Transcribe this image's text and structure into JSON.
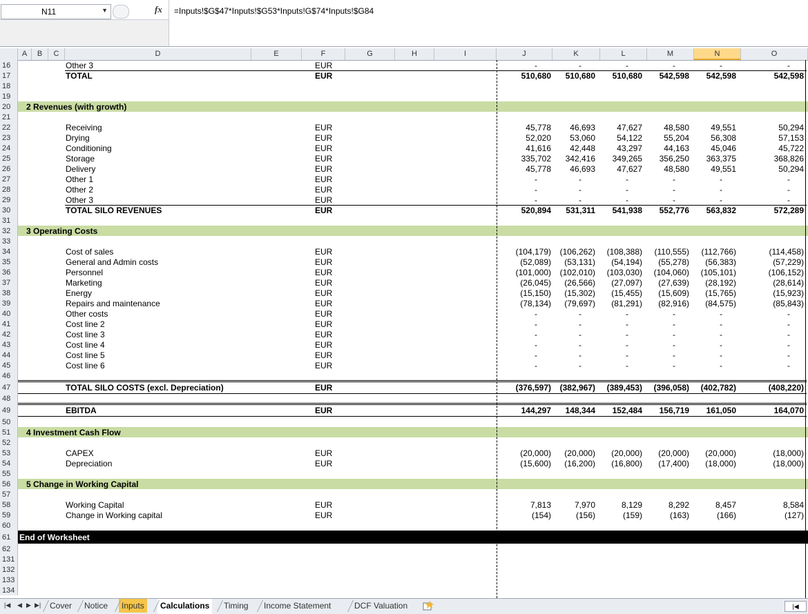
{
  "formula_bar": {
    "name_box": "N11",
    "fx_label": "fx",
    "formula": "=Inputs!$G$47*Inputs!$G53*Inputs!G$74*Inputs!$G84"
  },
  "columns": [
    "A",
    "B",
    "C",
    "D",
    "E",
    "F",
    "G",
    "H",
    "I",
    "J",
    "K",
    "L",
    "M",
    "N",
    "O"
  ],
  "selected_column": "N",
  "rows": [
    {
      "n": "16",
      "label": "Other 3",
      "unit": "EUR",
      "vals": [
        "-",
        "-",
        "-",
        "-",
        "-",
        "-"
      ]
    },
    {
      "n": "17",
      "label": "TOTAL",
      "unit": "EUR",
      "bold": true,
      "vals": [
        "510,680",
        "510,680",
        "510,680",
        "542,598",
        "542,598",
        "542,598"
      ]
    },
    {
      "n": "18"
    },
    {
      "n": "19"
    },
    {
      "n": "20",
      "section": "2  Revenues (with growth)"
    },
    {
      "n": "21"
    },
    {
      "n": "22",
      "label": "Receiving",
      "unit": "EUR",
      "vals": [
        "45,778",
        "46,693",
        "47,627",
        "48,580",
        "49,551",
        "50,294"
      ]
    },
    {
      "n": "23",
      "label": "Drying",
      "unit": "EUR",
      "vals": [
        "52,020",
        "53,060",
        "54,122",
        "55,204",
        "56,308",
        "57,153"
      ]
    },
    {
      "n": "24",
      "label": "Conditioning",
      "unit": "EUR",
      "vals": [
        "41,616",
        "42,448",
        "43,297",
        "44,163",
        "45,046",
        "45,722"
      ]
    },
    {
      "n": "25",
      "label": "Storage",
      "unit": "EUR",
      "vals": [
        "335,702",
        "342,416",
        "349,265",
        "356,250",
        "363,375",
        "368,826"
      ]
    },
    {
      "n": "26",
      "label": "Delivery",
      "unit": "EUR",
      "vals": [
        "45,778",
        "46,693",
        "47,627",
        "48,580",
        "49,551",
        "50,294"
      ]
    },
    {
      "n": "27",
      "label": "Other 1",
      "unit": "EUR",
      "vals": [
        "-",
        "-",
        "-",
        "-",
        "-",
        "-"
      ]
    },
    {
      "n": "28",
      "label": "Other 2",
      "unit": "EUR",
      "vals": [
        "-",
        "-",
        "-",
        "-",
        "-",
        "-"
      ]
    },
    {
      "n": "29",
      "label": "Other 3",
      "unit": "EUR",
      "vals": [
        "-",
        "-",
        "-",
        "-",
        "-",
        "-"
      ]
    },
    {
      "n": "30",
      "label": "TOTAL SILO REVENUES",
      "unit": "EUR",
      "bold": true,
      "vals": [
        "520,894",
        "531,311",
        "541,938",
        "552,776",
        "563,832",
        "572,289"
      ]
    },
    {
      "n": "31"
    },
    {
      "n": "32",
      "section": "3  Operating Costs"
    },
    {
      "n": "33"
    },
    {
      "n": "34",
      "label": "Cost of sales",
      "unit": "EUR",
      "vals": [
        "(104,179)",
        "(106,262)",
        "(108,388)",
        "(110,555)",
        "(112,766)",
        "(114,458)"
      ]
    },
    {
      "n": "35",
      "label": "General and Admin costs",
      "unit": "EUR",
      "vals": [
        "(52,089)",
        "(53,131)",
        "(54,194)",
        "(55,278)",
        "(56,383)",
        "(57,229)"
      ]
    },
    {
      "n": "36",
      "label": "Personnel",
      "unit": "EUR",
      "vals": [
        "(101,000)",
        "(102,010)",
        "(103,030)",
        "(104,060)",
        "(105,101)",
        "(106,152)"
      ]
    },
    {
      "n": "37",
      "label": "Marketing",
      "unit": "EUR",
      "vals": [
        "(26,045)",
        "(26,566)",
        "(27,097)",
        "(27,639)",
        "(28,192)",
        "(28,614)"
      ]
    },
    {
      "n": "38",
      "label": "Energy",
      "unit": "EUR",
      "vals": [
        "(15,150)",
        "(15,302)",
        "(15,455)",
        "(15,609)",
        "(15,765)",
        "(15,923)"
      ]
    },
    {
      "n": "39",
      "label": "Repairs and maintenance",
      "unit": "EUR",
      "vals": [
        "(78,134)",
        "(79,697)",
        "(81,291)",
        "(82,916)",
        "(84,575)",
        "(85,843)"
      ]
    },
    {
      "n": "40",
      "label": "Other costs",
      "unit": "EUR",
      "vals": [
        "-",
        "-",
        "-",
        "-",
        "-",
        "-"
      ]
    },
    {
      "n": "41",
      "label": "Cost line 2",
      "unit": "EUR",
      "vals": [
        "-",
        "-",
        "-",
        "-",
        "-",
        "-"
      ]
    },
    {
      "n": "42",
      "label": "Cost line 3",
      "unit": "EUR",
      "vals": [
        "-",
        "-",
        "-",
        "-",
        "-",
        "-"
      ]
    },
    {
      "n": "43",
      "label": "Cost line 4",
      "unit": "EUR",
      "vals": [
        "-",
        "-",
        "-",
        "-",
        "-",
        "-"
      ]
    },
    {
      "n": "44",
      "label": "Cost line 5",
      "unit": "EUR",
      "vals": [
        "-",
        "-",
        "-",
        "-",
        "-",
        "-"
      ]
    },
    {
      "n": "45",
      "label": "Cost line 6",
      "unit": "EUR",
      "vals": [
        "-",
        "-",
        "-",
        "-",
        "-",
        "-"
      ]
    },
    {
      "n": "46"
    },
    {
      "n": "47",
      "label": "TOTAL SILO COSTS (excl. Depreciation)",
      "unit": "EUR",
      "bold": true,
      "boxed": true,
      "vals": [
        "(376,597)",
        "(382,967)",
        "(389,453)",
        "(396,058)",
        "(402,782)",
        "(408,220)"
      ]
    },
    {
      "n": "48"
    },
    {
      "n": "49",
      "label": "EBITDA",
      "unit": "EUR",
      "bold": true,
      "boxed": true,
      "vals": [
        "144,297",
        "148,344",
        "152,484",
        "156,719",
        "161,050",
        "164,070"
      ]
    },
    {
      "n": "50"
    },
    {
      "n": "51",
      "section": "4  Investment Cash Flow"
    },
    {
      "n": "52"
    },
    {
      "n": "53",
      "label": "CAPEX",
      "unit": "EUR",
      "vals": [
        "(20,000)",
        "(20,000)",
        "(20,000)",
        "(20,000)",
        "(20,000)",
        "(18,000)"
      ]
    },
    {
      "n": "54",
      "label": "Depreciation",
      "unit": "EUR",
      "vals": [
        "(15,600)",
        "(16,200)",
        "(16,800)",
        "(17,400)",
        "(18,000)",
        "(18,000)"
      ]
    },
    {
      "n": "55"
    },
    {
      "n": "56",
      "section": "5  Change in Working Capital"
    },
    {
      "n": "57"
    },
    {
      "n": "58",
      "label": "Working Capital",
      "unit": "EUR",
      "vals": [
        "7,813",
        "7,970",
        "8,129",
        "8,292",
        "8,457",
        "8,584"
      ]
    },
    {
      "n": "59",
      "label": "Change in Working capital",
      "unit": "EUR",
      "vals": [
        "(154)",
        "(156)",
        "(159)",
        "(163)",
        "(166)",
        "(127)"
      ]
    },
    {
      "n": "60"
    },
    {
      "n": "61",
      "end": "End of Worksheet"
    },
    {
      "n": "62"
    },
    {
      "n": "131"
    },
    {
      "n": "132"
    },
    {
      "n": "133"
    },
    {
      "n": "134"
    }
  ],
  "sheet_tabs": [
    "Cover",
    "Notice",
    "Inputs",
    "Calculations",
    "Timing",
    "Income Statement",
    "DCF Valuation"
  ],
  "active_tab": "Calculations",
  "highlight_tab": "Inputs"
}
